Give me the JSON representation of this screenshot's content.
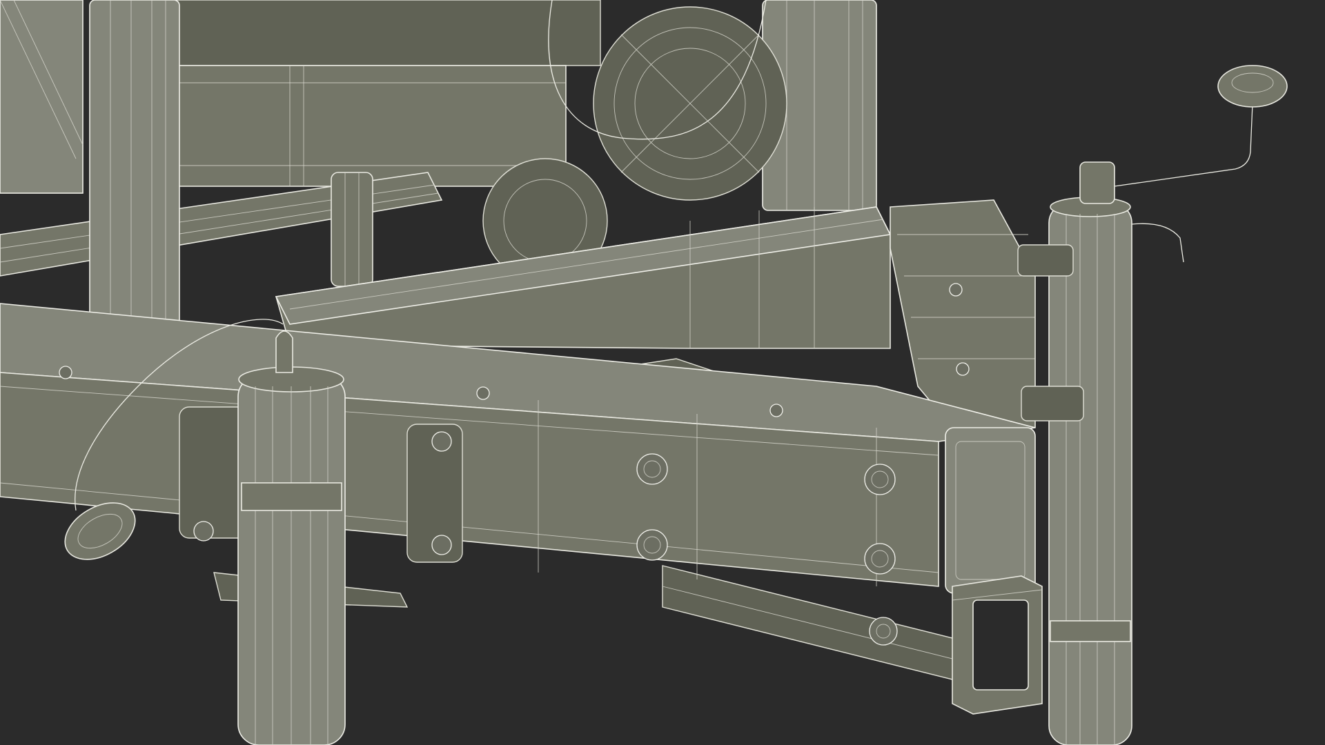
{
  "image": {
    "subject": "trailer-tongue-wireframe",
    "colors": {
      "background": "#2b2b2b",
      "metal": "#747668",
      "metal_dark": "#606255",
      "wire": "#e9e9e1"
    }
  }
}
